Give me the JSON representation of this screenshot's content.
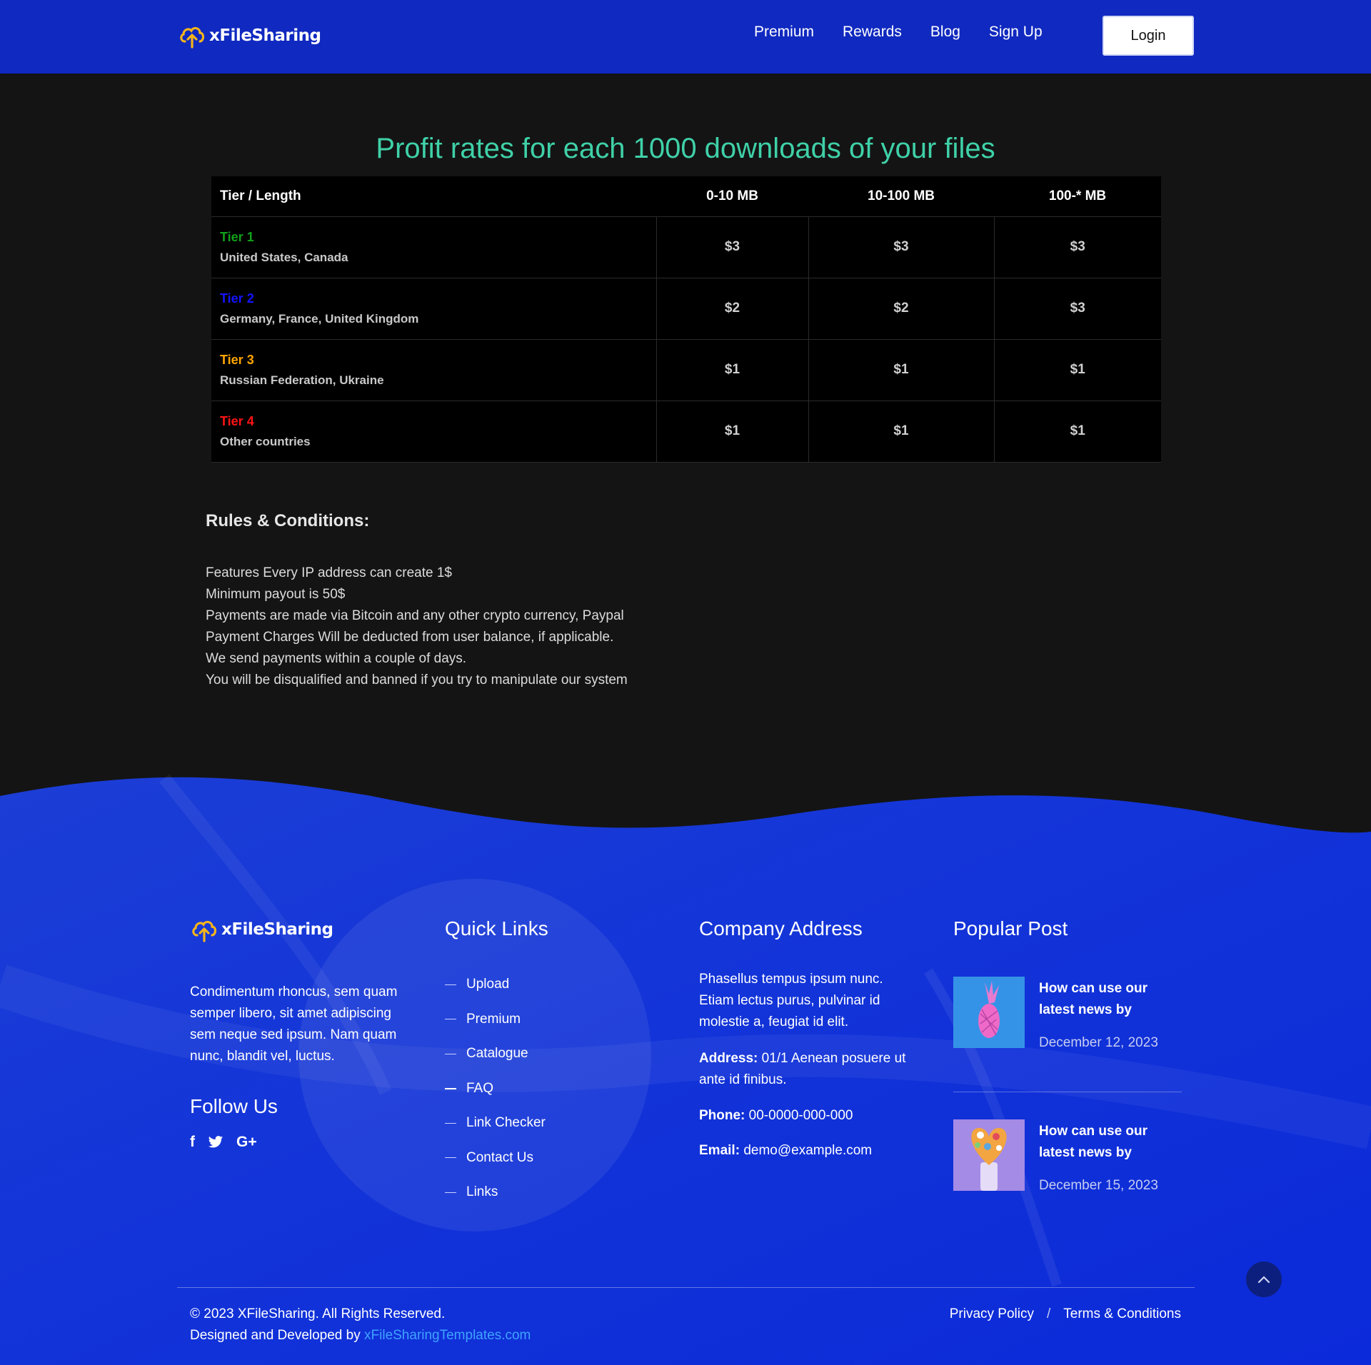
{
  "header": {
    "brand": "xFileSharing",
    "nav": [
      "Premium",
      "Rewards",
      "Blog",
      "Sign Up"
    ],
    "login_label": "Login"
  },
  "rates": {
    "title": "Profit rates for each 1000 downloads of your files",
    "columns": [
      "Tier / Length",
      "0-10 MB",
      "10-100 MB",
      "100-* MB"
    ],
    "rows": [
      {
        "tier": "Tier 1",
        "color": "#11a21a",
        "countries": "United States, Canada",
        "values": [
          "$3",
          "$3",
          "$3"
        ]
      },
      {
        "tier": "Tier 2",
        "color": "#1414ff",
        "countries": "Germany, France, United Kingdom",
        "values": [
          "$2",
          "$2",
          "$3"
        ]
      },
      {
        "tier": "Tier 3",
        "color": "#ffa500",
        "countries": "Russian Federation, Ukraine",
        "values": [
          "$1",
          "$1",
          "$1"
        ]
      },
      {
        "tier": "Tier 4",
        "color": "#ff1414",
        "countries": "Other countries",
        "values": [
          "$1",
          "$1",
          "$1"
        ]
      }
    ]
  },
  "rules": {
    "title": "Rules & Conditions:",
    "items": [
      "Features Every IP address can create 1$",
      "Minimum payout is 50$",
      "Payments are made via Bitcoin and any other crypto currency, Paypal",
      "Payment Charges Will be deducted from user balance, if applicable.",
      "We send payments within a couple of days.",
      "You will be disqualified and banned if you try to manipulate our system"
    ]
  },
  "footer": {
    "brand": "xFileSharing",
    "about": "Condimentum rhoncus, sem quam semper libero, sit amet adipiscing sem neque sed ipsum. Nam quam nunc, blandit vel, luctus.",
    "follow_title": "Follow Us",
    "social_icons": [
      "facebook-icon",
      "twitter-icon",
      "google-plus-icon"
    ],
    "quick_links_title": "Quick Links",
    "quick_links": [
      "Upload",
      "Premium",
      "Catalogue",
      "FAQ",
      "Link Checker",
      "Contact Us",
      "Links"
    ],
    "address_title": "Company Address",
    "address_intro": "Phasellus tempus ipsum nunc. Etiam lectus purus, pulvinar id molestie a, feugiat id elit.",
    "address_label": "Address:",
    "address_value": "01/1 Aenean posuere ut ante id finibus.",
    "phone_label": "Phone:",
    "phone_value": "00-0000-000-000",
    "email_label": "Email:",
    "email_value": "demo@example.com",
    "posts_title": "Popular Post",
    "posts": [
      {
        "title": "How can use our latest news by",
        "date": "December 12, 2023"
      },
      {
        "title": "How can use our latest news by",
        "date": "December 15, 2023"
      }
    ],
    "copyright": "© 2023 XFileSharing. All Rights Reserved.",
    "designed_by": "Designed and Developed by",
    "designed_link": "xFileSharingTemplates.com",
    "legal": [
      "Privacy Policy",
      "/",
      "Terms & Conditions"
    ]
  }
}
